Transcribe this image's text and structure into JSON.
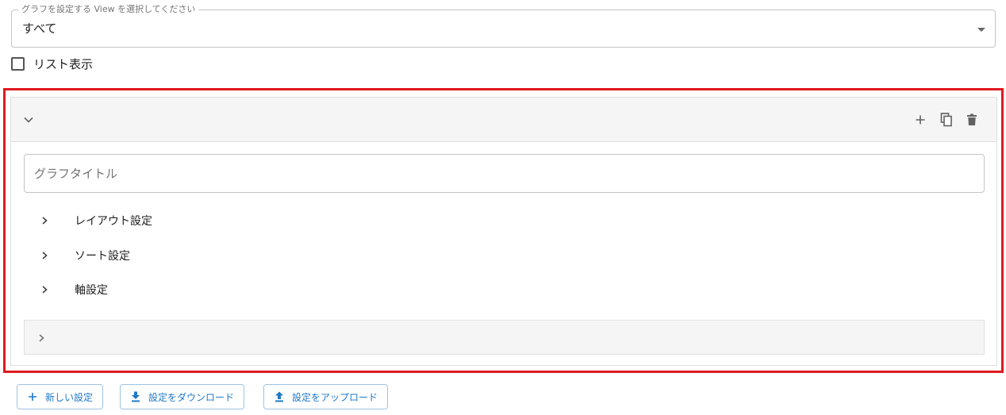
{
  "view_select": {
    "legend": "グラフを設定する View を選択してください",
    "value": "すべて"
  },
  "list_display": {
    "label": "リスト表示",
    "checked": false
  },
  "graph_panel": {
    "title_placeholder": "グラフタイトル",
    "sections": [
      {
        "label": "レイアウト設定"
      },
      {
        "label": "ソート設定"
      },
      {
        "label": "軸設定"
      }
    ]
  },
  "footer_buttons": {
    "new_label": "新しい設定",
    "download_label": "設定をダウンロード",
    "upload_label": "設定をアップロード"
  },
  "colors": {
    "highlight_border": "#e0191f",
    "button_accent": "#1e78c8"
  }
}
